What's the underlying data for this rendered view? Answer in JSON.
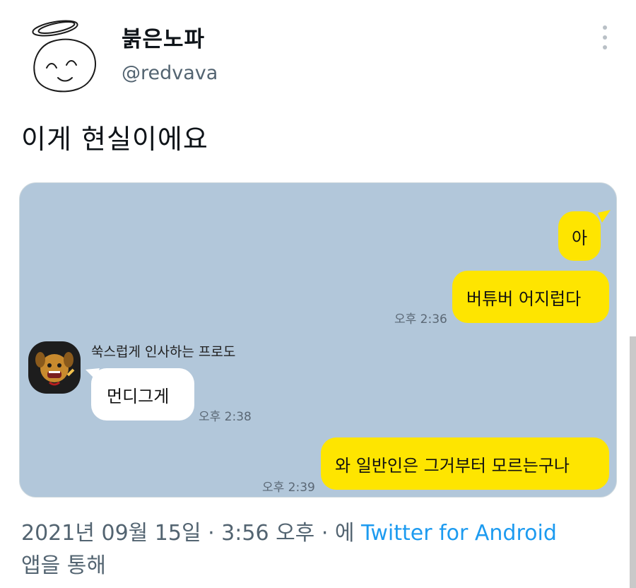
{
  "user": {
    "display_name": "붉은노파",
    "handle": "@redvava",
    "avatar_icon": "hand-drawn-smiley-face-with-halo"
  },
  "tweet": {
    "text": "이게 현실이에요"
  },
  "chat": {
    "background": "#b2c7da",
    "my_bubble_color": "#fee500",
    "messages": [
      {
        "text": "아"
      },
      {
        "text": "버튜버 어지럽다",
        "time": "오후 2:36"
      },
      {
        "sender": "쑥스럽게 인사하는 프로도",
        "text": "먼디그게",
        "time": "오후 2:38"
      },
      {
        "text": "와 일반인은 그거부터 모르는구나",
        "time": "오후 2:39"
      }
    ]
  },
  "footer": {
    "timestamp": "2021년 09월 15일 · 3:56 오후 · 에 ",
    "source_link": "Twitter for Android",
    "suffix": "앱을 통해",
    "link_color": "#1d9bf0"
  }
}
